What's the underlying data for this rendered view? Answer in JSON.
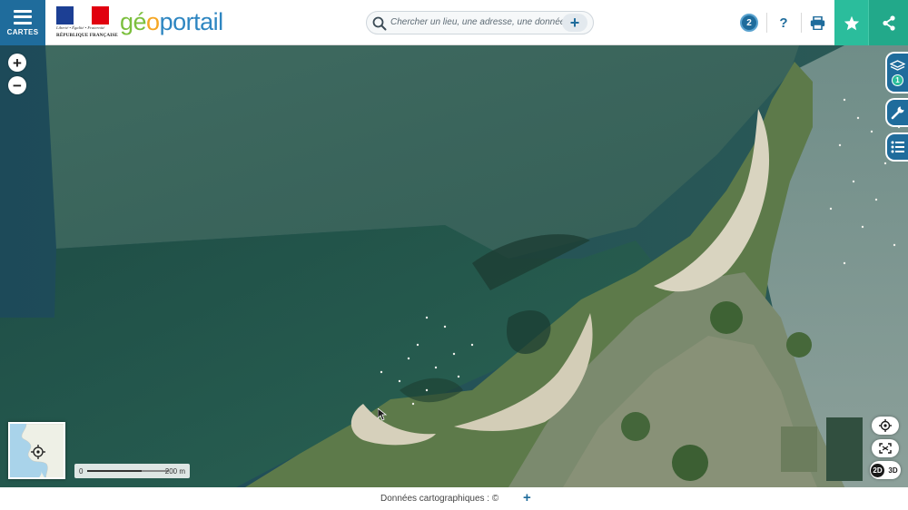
{
  "header": {
    "menu_label": "CARTES",
    "republique": {
      "motto": "Liberté • Égalité • Fraternité",
      "name": "RÉPUBLIQUE FRANÇAISE"
    },
    "brand": {
      "part1": "gé",
      "part2": "o",
      "part3": "portail"
    },
    "search": {
      "placeholder": "Chercher un lieu, une adresse, une donnée"
    },
    "notification_count": "2",
    "help_label": "?"
  },
  "map": {
    "layers_count": "1",
    "scale": {
      "start": "0",
      "end": "200 m"
    },
    "view_toggle": {
      "option_2d": "2D",
      "option_3d": "3D",
      "active": "2D"
    }
  },
  "footer": {
    "attribution": "Données cartographiques : ©",
    "more_label": "+"
  },
  "colors": {
    "primary": "#1f6c9c",
    "accent_green": "#2bbd9c",
    "flag_blue": "#1c3f94",
    "flag_red": "#e1000f"
  }
}
